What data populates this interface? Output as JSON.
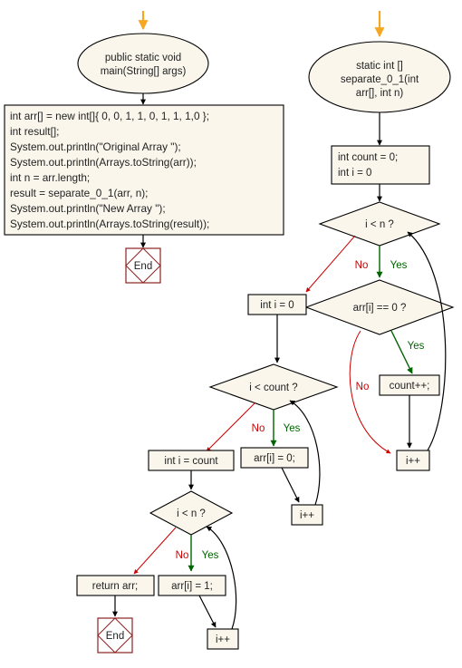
{
  "diagram": {
    "title": "separate_0_1 flowchart",
    "colors": {
      "shape_fill": "#faf6ec",
      "stroke": "#000000",
      "no_label": "#cc0000",
      "yes_label": "#006400",
      "entry_arrow": "#f5a623",
      "end_node": "#8b2222",
      "background": "#ffffff"
    }
  },
  "left": {
    "start": "public static void main(String[] args)",
    "start_line1": "public static void",
    "start_line2": "main(String[] args)",
    "code_lines": [
      "int arr[] = new int[]{ 0, 0, 1, 1, 0, 1, 1, 1,0 };",
      "int result[];",
      "System.out.println(\"Original Array \");",
      "System.out.println(Arrays.toString(arr));",
      "int n = arr.length;",
      "result = separate_0_1(arr, n);",
      "System.out.println(\"New Array \");",
      "System.out.println(Arrays.toString(result));"
    ],
    "end": "End"
  },
  "right": {
    "start_line1": "static int []",
    "start_line2": "separate_0_1(int",
    "start_line3": "arr[], int n)",
    "init_line1": "int count = 0;",
    "init_line2": "int i = 0",
    "decision_loop1": "i < n ?",
    "decision_zero": "arr[i] == 0 ?",
    "count_inc": "count++;",
    "incr1": "i++",
    "no": "No",
    "yes": "Yes"
  },
  "middle": {
    "init_i": "int i = 0",
    "decision_count": "i < count ?",
    "assign_zero": "arr[i] = 0;",
    "incr2": "i++",
    "init_i_count": "int i = count",
    "decision_n2": "i < n ?",
    "assign_one": "arr[i] = 1;",
    "incr3": "i++",
    "return_arr": "return arr;",
    "end": "End",
    "no": "No",
    "yes": "Yes"
  }
}
